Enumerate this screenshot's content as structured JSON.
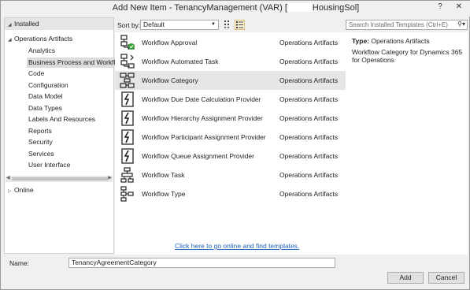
{
  "window": {
    "title_prefix": "Add New Item - TenancyManagement (VAR) [",
    "title_suffix": "HousingSol]",
    "help_label": "?",
    "close_label": "✕"
  },
  "tree": {
    "installed_label": "Installed",
    "operations_artifacts_label": "Operations Artifacts",
    "children": [
      "Analytics",
      "Business Process and Workflow",
      "Code",
      "Configuration",
      "Data Model",
      "Data Types",
      "Labels And Resources",
      "Reports",
      "Security",
      "Services",
      "User Interface"
    ],
    "selected_index": 1,
    "online_label": "Online"
  },
  "toolbar": {
    "sort_by_label": "Sort by:",
    "sort_by_value": "Default"
  },
  "items": [
    {
      "name": "Workflow Approval",
      "category": "Operations Artifacts",
      "icon": "workflow-approval-icon"
    },
    {
      "name": "Workflow Automated Task",
      "category": "Operations Artifacts",
      "icon": "workflow-automated-task-icon"
    },
    {
      "name": "Workflow Category",
      "category": "Operations Artifacts",
      "icon": "workflow-category-icon"
    },
    {
      "name": "Workflow Due Date Calculation Provider",
      "category": "Operations Artifacts",
      "icon": "workflow-provider-icon"
    },
    {
      "name": "Workflow Hierarchy Assignment Provider",
      "category": "Operations Artifacts",
      "icon": "workflow-provider-icon"
    },
    {
      "name": "Workflow Participant Assignment Provider",
      "category": "Operations Artifacts",
      "icon": "workflow-provider-icon"
    },
    {
      "name": "Workflow Queue Assignment Provider",
      "category": "Operations Artifacts",
      "icon": "workflow-provider-icon"
    },
    {
      "name": "Workflow Task",
      "category": "Operations Artifacts",
      "icon": "workflow-task-icon"
    },
    {
      "name": "Workflow Type",
      "category": "Operations Artifacts",
      "icon": "workflow-type-icon"
    }
  ],
  "selected_item_index": 2,
  "online_link": "Click here to go online and find templates.",
  "search": {
    "placeholder": "Search Installed Templates (Ctrl+E)"
  },
  "details": {
    "type_label": "Type:",
    "type_value": "Operations Artifacts",
    "description": "Workflow Category for Dynamics 365 for Operations"
  },
  "name_field": {
    "label": "Name:",
    "value": "TenancyAgreementCategory"
  },
  "buttons": {
    "add": "Add",
    "cancel": "Cancel"
  },
  "colors": {
    "link": "#1f5fb8",
    "selection": "#e6e6e6",
    "green_check": "#3aa335"
  }
}
